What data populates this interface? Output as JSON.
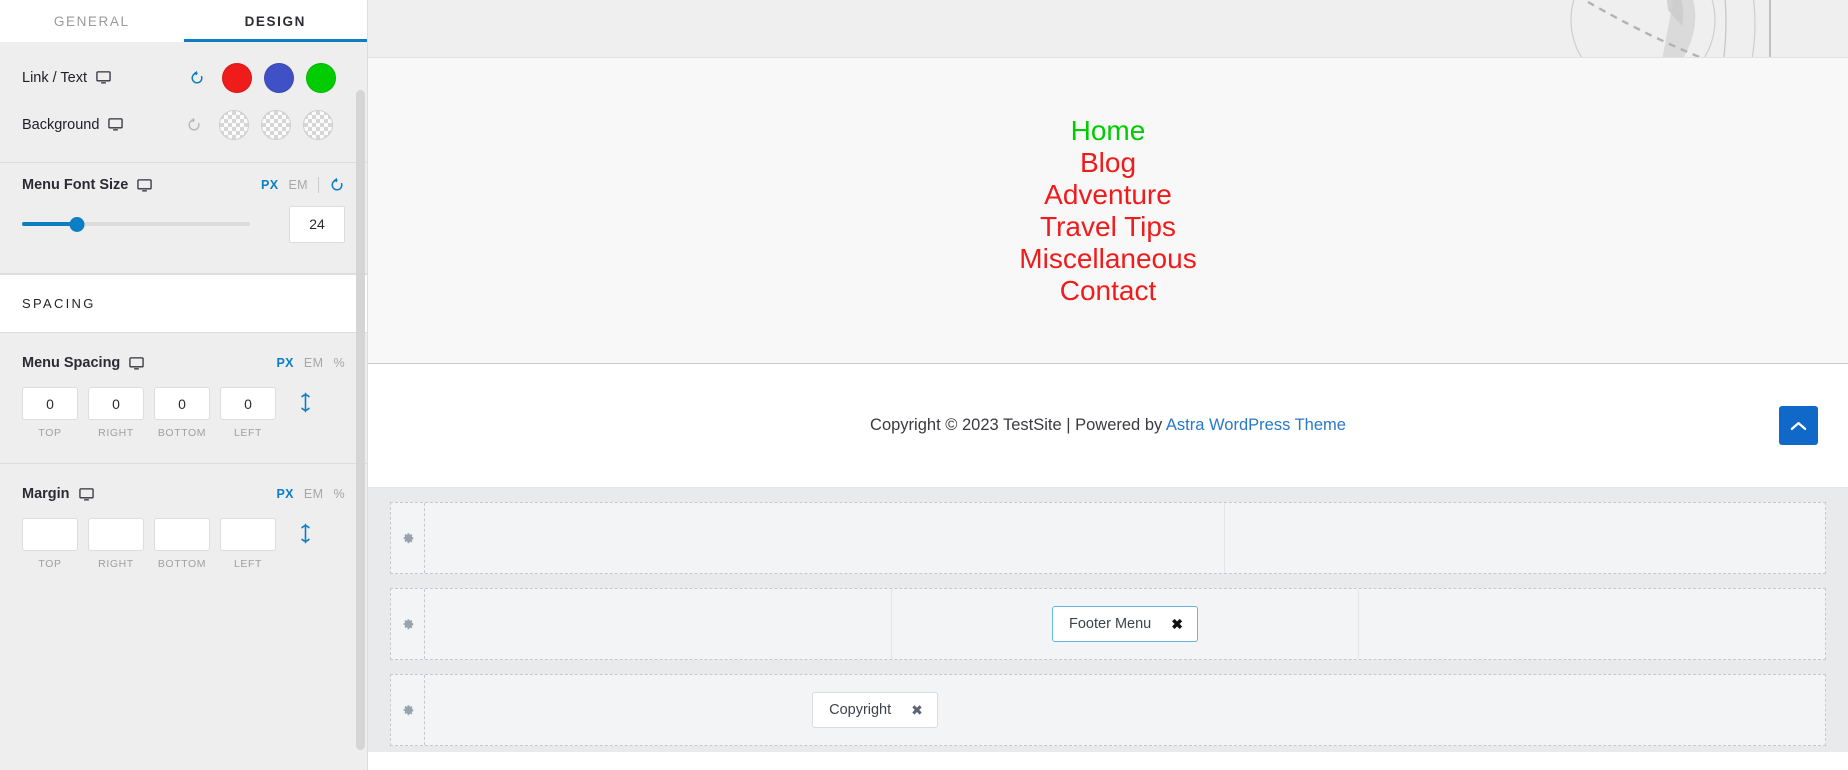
{
  "sidebar": {
    "tabs": [
      {
        "label": "GENERAL",
        "active": false
      },
      {
        "label": "DESIGN",
        "active": true
      }
    ],
    "colors": {
      "link_text": {
        "label": "Link / Text",
        "reset_icon": "reset-icon",
        "device_icon": "desktop-icon",
        "swatches": [
          "#f01b1b",
          "#4051c8",
          "#00cc00"
        ]
      },
      "background": {
        "label": "Background",
        "reset_icon": "reset-icon",
        "device_icon": "desktop-icon",
        "swatches": [
          "transparent",
          "transparent",
          "transparent"
        ]
      }
    },
    "menu_font_size": {
      "label": "Menu Font Size",
      "device_icon": "desktop-icon",
      "units": [
        {
          "label": "PX",
          "active": true
        },
        {
          "label": "EM",
          "active": false
        }
      ],
      "reset_icon": "reset-icon",
      "value": "24",
      "slider_percent": 24
    },
    "spacing_section_title": "SPACING",
    "menu_spacing": {
      "label": "Menu Spacing",
      "device_icon": "desktop-icon",
      "units": [
        {
          "label": "PX",
          "active": true
        },
        {
          "label": "EM",
          "active": false
        },
        {
          "label": "%",
          "active": false
        }
      ],
      "fields": [
        {
          "caption": "TOP",
          "value": "0"
        },
        {
          "caption": "RIGHT",
          "value": "0"
        },
        {
          "caption": "BOTTOM",
          "value": "0"
        },
        {
          "caption": "LEFT",
          "value": "0"
        }
      ],
      "link_icon": "link-values-icon"
    },
    "margin": {
      "label": "Margin",
      "device_icon": "desktop-icon",
      "units": [
        {
          "label": "PX",
          "active": true
        },
        {
          "label": "EM",
          "active": false
        },
        {
          "label": "%",
          "active": false
        }
      ],
      "fields": [
        {
          "caption": "TOP",
          "value": ""
        },
        {
          "caption": "RIGHT",
          "value": ""
        },
        {
          "caption": "BOTTOM",
          "value": ""
        },
        {
          "caption": "LEFT",
          "value": ""
        }
      ],
      "link_icon": "link-values-icon"
    }
  },
  "preview": {
    "menu_items": [
      {
        "label": "Home",
        "color": "#00cc00"
      },
      {
        "label": "Blog",
        "color": "#f01b1b"
      },
      {
        "label": "Adventure",
        "color": "#f01b1b"
      },
      {
        "label": "Travel Tips",
        "color": "#f01b1b"
      },
      {
        "label": "Miscellaneous",
        "color": "#f01b1b"
      },
      {
        "label": "Contact",
        "color": "#f01b1b"
      }
    ],
    "copyright": {
      "prefix": "Copyright © 2023 TestSite | Powered by ",
      "link": "Astra WordPress Theme"
    },
    "scroll_top_icon": "chevron-up-icon"
  },
  "footer_builder": {
    "rows": [
      {
        "gear_icon": "gear-icon",
        "columns": 2,
        "chip": null,
        "chip_column": -1
      },
      {
        "gear_icon": "gear-icon",
        "columns": 3,
        "chip": {
          "label": "Footer Menu",
          "selected": true,
          "close_icon": "close-icon"
        },
        "chip_column": 1
      },
      {
        "gear_icon": "gear-icon",
        "columns": 1,
        "chip": {
          "label": "Copyright",
          "selected": false,
          "close_icon": "close-icon"
        },
        "chip_column": 0
      }
    ]
  },
  "theme": {
    "accent": "#0c7ec4",
    "link_blue": "#2878c8",
    "button_blue": "#1068c8"
  }
}
